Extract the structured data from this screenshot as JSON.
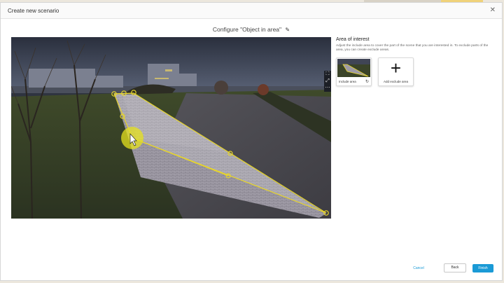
{
  "dialog": {
    "title": "Create new scenario",
    "close_icon": "close-icon"
  },
  "config": {
    "label": "Configure",
    "scenario_name": "\"Object in area\"",
    "edit_icon": "pencil-icon"
  },
  "camera": {
    "toolbar_icons": [
      "fullscreen-icon",
      "fit-icon",
      "more-icon"
    ]
  },
  "panel": {
    "title": "Area of interest",
    "description": "Adjust the include area to cover the part of the scene that you are interested in. To exclude parts of the area, you can create exclude areas.",
    "include_label": "Include area",
    "include_icon": "reset-icon",
    "exclude_label": "Add exclude area",
    "exclude_icon": "plus-icon"
  },
  "footer": {
    "cancel": "Cancel",
    "back": "Back",
    "finish": "Finish"
  },
  "colors": {
    "accent": "#1a9ad6",
    "polygon": "#e8d62a"
  }
}
